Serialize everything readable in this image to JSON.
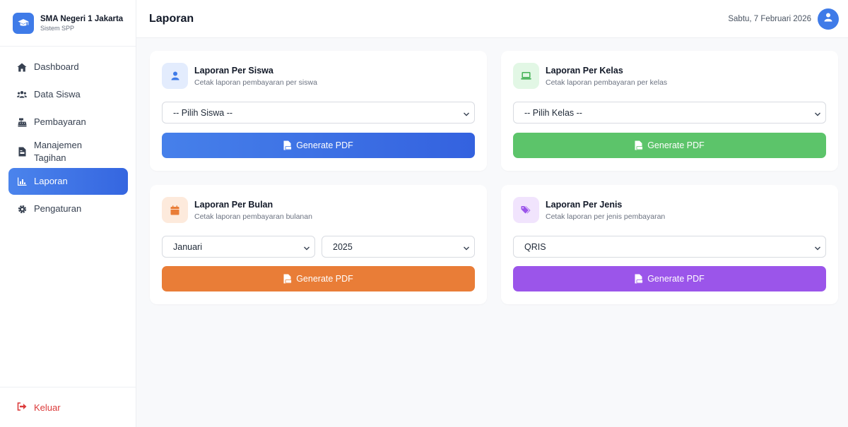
{
  "brand": {
    "name": "SMA Negeri 1 Jakarta",
    "subtitle": "Sistem SPP"
  },
  "nav": [
    {
      "label": "Dashboard"
    },
    {
      "label": "Data Siswa"
    },
    {
      "label": "Pembayaran"
    },
    {
      "label": "Manajemen Tagihan"
    },
    {
      "label": "Laporan"
    },
    {
      "label": "Pengaturan"
    }
  ],
  "logout_label": "Keluar",
  "header": {
    "title": "Laporan",
    "date": "Sabtu, 7 Februari 2026"
  },
  "cards": {
    "siswa": {
      "title": "Laporan Per Siswa",
      "desc": "Cetak laporan pembayaran per siswa",
      "select_value": "-- Pilih Siswa --",
      "button": "Generate PDF"
    },
    "kelas": {
      "title": "Laporan Per Kelas",
      "desc": "Cetak laporan pembayaran per kelas",
      "select_value": "-- Pilih Kelas --",
      "button": "Generate PDF"
    },
    "bulan": {
      "title": "Laporan Per Bulan",
      "desc": "Cetak laporan pembayaran bulanan",
      "month_value": "Januari",
      "year_value": "2025",
      "button": "Generate PDF"
    },
    "jenis": {
      "title": "Laporan Per Jenis",
      "desc": "Cetak laporan per jenis pembayaran",
      "select_value": "QRIS",
      "button": "Generate PDF"
    }
  },
  "colors": {
    "primary": "#3f7be8",
    "siswa_button": "#3d74e6",
    "kelas_button": "#5cc46a",
    "bulan_button": "#e97d37",
    "jenis_button": "#9b55ea",
    "logout": "#dc3b3b"
  },
  "icons": {
    "brand": "graduation-cap-icon",
    "nav": [
      "home-icon",
      "users-icon",
      "cash-register-icon",
      "file-invoice-icon",
      "chart-icon",
      "gear-icon"
    ],
    "logout": "sign-out-icon",
    "avatar": "user-icon",
    "card_siswa": "user-icon",
    "card_kelas": "laptop-icon",
    "card_bulan": "calendar-icon",
    "card_jenis": "tags-icon",
    "button": "file-pdf-icon"
  }
}
